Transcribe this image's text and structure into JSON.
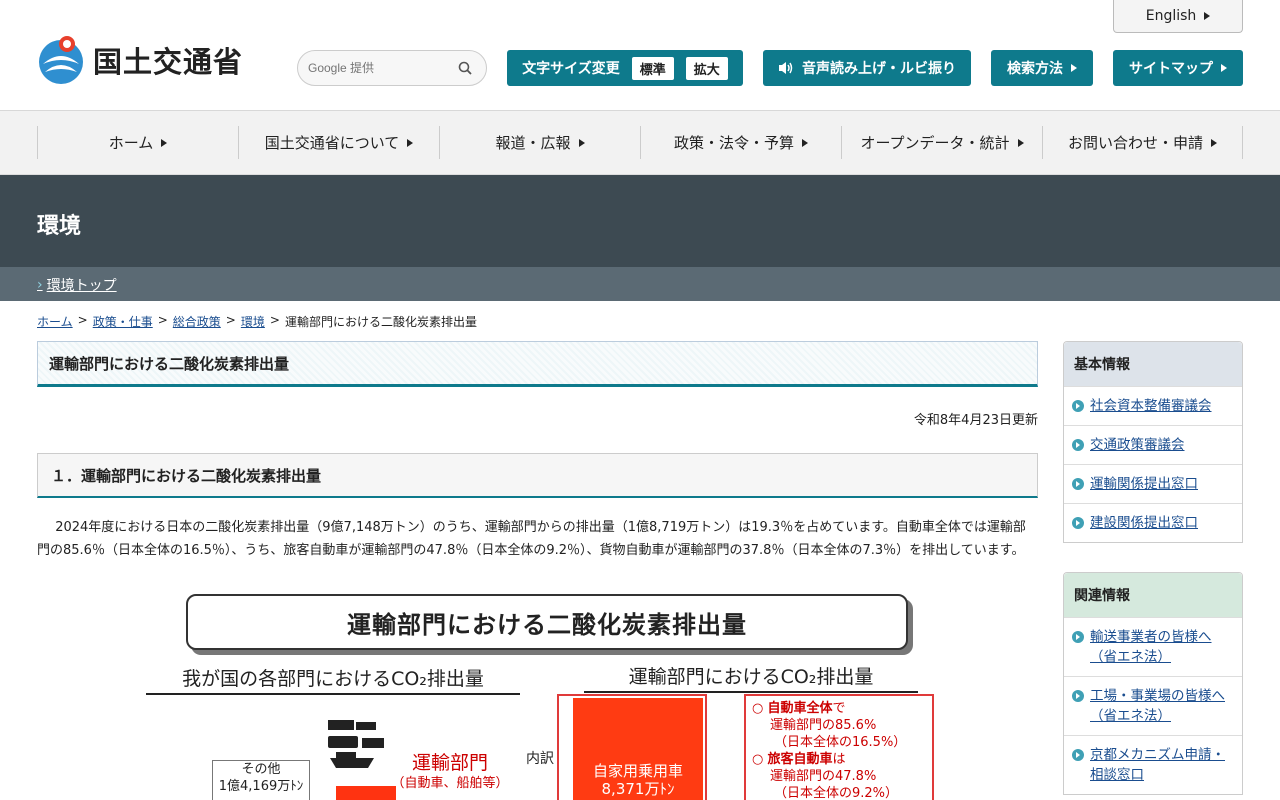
{
  "header": {
    "logo_text": "国土交通省",
    "english_label": "English",
    "search_placeholder": "Google 提供",
    "font_size_label": "文字サイズ変更",
    "font_size_normal": "標準",
    "font_size_large": "拡大",
    "speech_label": "音声読み上げ・ルビ振り",
    "search_method_label": "検索方法",
    "sitemap_label": "サイトマップ"
  },
  "gnav": {
    "items": [
      {
        "label": "ホーム"
      },
      {
        "label": "国土交通省について"
      },
      {
        "label": "報道・広報"
      },
      {
        "label": "政策・法令・予算"
      },
      {
        "label": "オープンデータ・統計"
      },
      {
        "label": "お問い合わせ・申請"
      }
    ]
  },
  "category": {
    "title": "環境",
    "sub_link": "環境トップ"
  },
  "breadcrumb": {
    "items": [
      "ホーム",
      "政策・仕事",
      "総合政策",
      "環境"
    ],
    "current": "運輸部門における二酸化炭素排出量"
  },
  "main": {
    "title": "運輸部門における二酸化炭素排出量",
    "updated": "令和8年4月23日更新",
    "section1_title": "１．運輸部門における二酸化炭素排出量",
    "section1_text": "2024年度における日本の二酸化炭素排出量（9億7,148万トン）のうち、運輸部門からの排出量（1億8,719万トン）は19.3％を占めています。自動車全体では運輸部門の85.6％（日本全体の16.5％）、うち、旅客自動車が運輸部門の47.8％（日本全体の9.2％）、貨物自動車が運輸部門の37.8％（日本全体の7.3％）を排出しています。"
  },
  "figure": {
    "title": "運輸部門における二酸化炭素排出量",
    "left_subtitle": "我が国の各部門におけるCO₂排出量",
    "right_subtitle": "運輸部門におけるCO₂排出量",
    "other_label": "その他",
    "other_value": "1億4,169万ﾄﾝ",
    "transport_label": "運輸部門",
    "transport_sub": "（自動車、船舶等）",
    "detail_label": "内訳",
    "car_label": "自家用乗用車",
    "car_value": "8,371万ﾄﾝ",
    "note1_head": "自動車全体",
    "note1_tail": "で",
    "note1_line2": "運輸部門の85.6%",
    "note1_line3": "（日本全体の16.5%）",
    "note2_head": "旅客自動車",
    "note2_tail": "は",
    "note2_line2": "運輸部門の47.8%",
    "note2_line3": "（日本全体の9.2%）"
  },
  "sidebar": {
    "basic_title": "基本情報",
    "basic_items": [
      {
        "label": "社会資本整備審議会"
      },
      {
        "label": "交通政策審議会"
      },
      {
        "label": "運輸関係提出窓口"
      },
      {
        "label": "建設関係提出窓口"
      }
    ],
    "related_title": "関連情報",
    "related_items": [
      {
        "label": "輸送事業者の皆様へ（省エネ法）"
      },
      {
        "label": "工場・事業場の皆様へ（省エネ法）"
      },
      {
        "label": "京都メカニズム申請・相談窓口"
      }
    ]
  },
  "colors": {
    "accent_teal": "#0e7a8c",
    "band_dark": "#3d4a52",
    "band_sub": "#5b6a74",
    "figure_red": "#ff3b12"
  }
}
